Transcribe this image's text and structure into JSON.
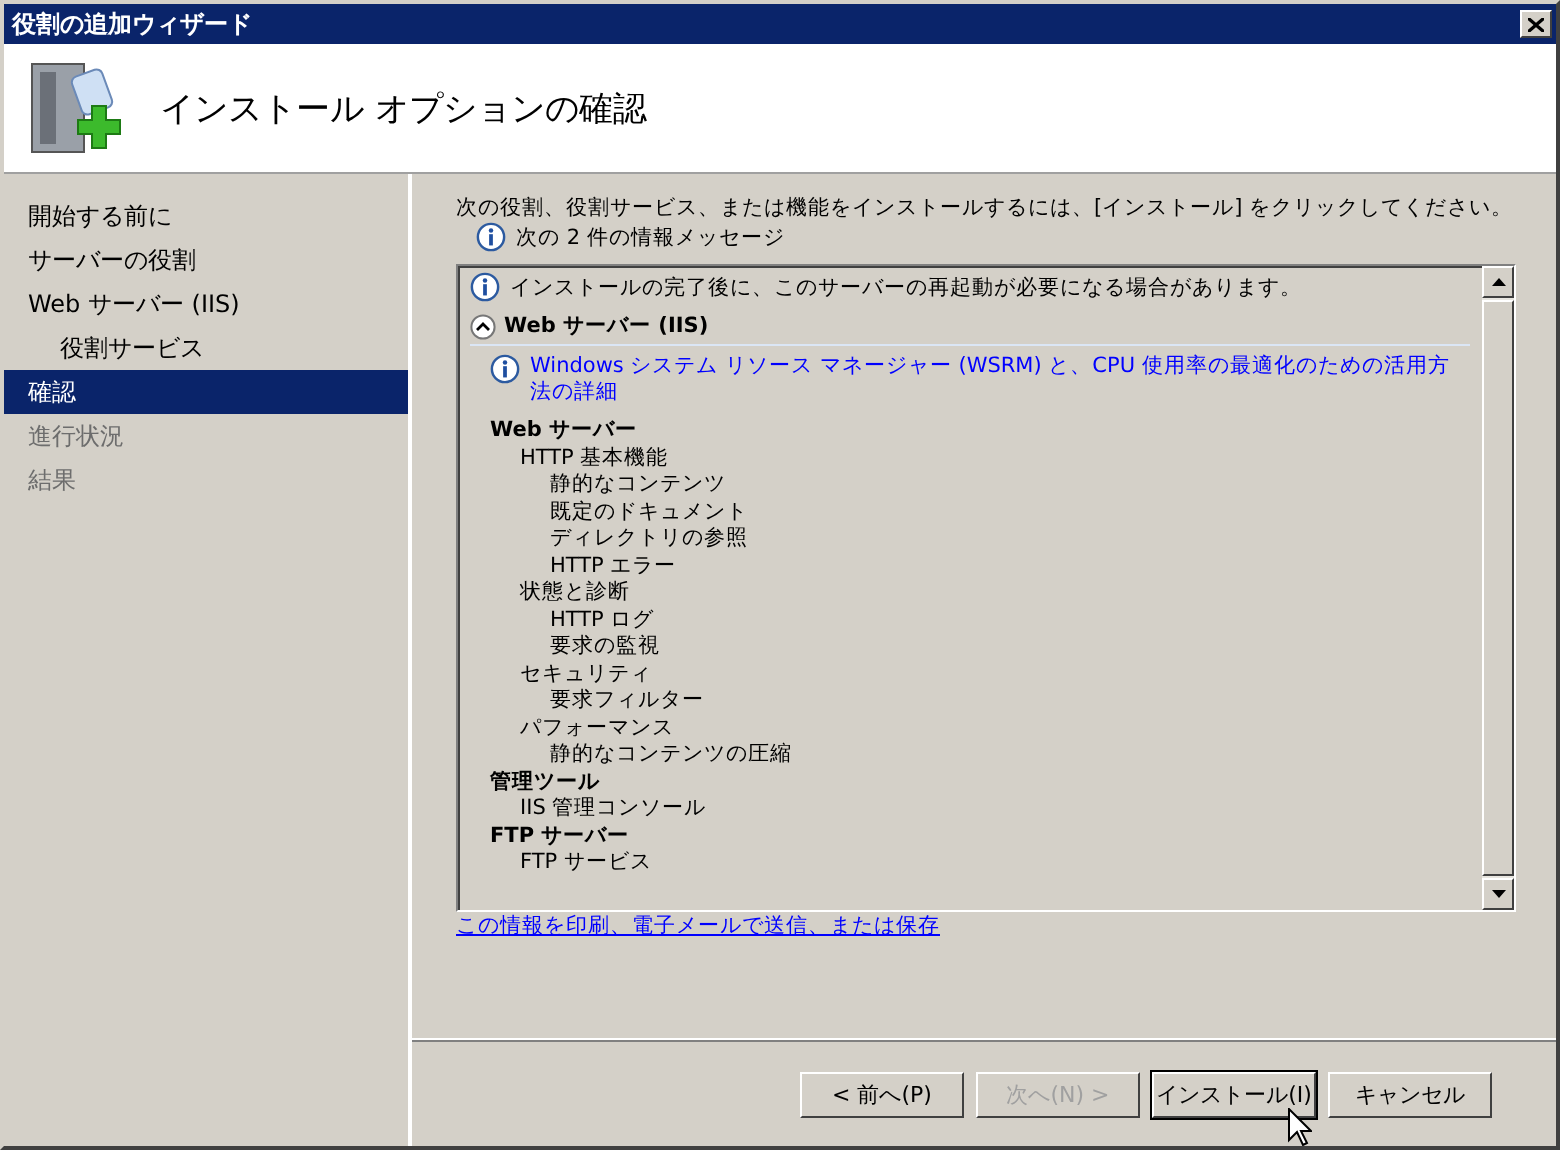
{
  "window": {
    "title": "役割の追加ウィザード"
  },
  "header": {
    "title": "インストール オプションの確認"
  },
  "sidebar": {
    "items": [
      {
        "label": "開始する前に",
        "selected": false,
        "disabled": false,
        "indented": false
      },
      {
        "label": "サーバーの役割",
        "selected": false,
        "disabled": false,
        "indented": false
      },
      {
        "label": "Web サーバー (IIS)",
        "selected": false,
        "disabled": false,
        "indented": false
      },
      {
        "label": "役割サービス",
        "selected": false,
        "disabled": false,
        "indented": true
      },
      {
        "label": "確認",
        "selected": true,
        "disabled": false,
        "indented": false
      },
      {
        "label": "進行状況",
        "selected": false,
        "disabled": true,
        "indented": false
      },
      {
        "label": "結果",
        "selected": false,
        "disabled": true,
        "indented": false
      }
    ]
  },
  "content": {
    "instruction": "次の役割、役割サービス、または機能をインストールするには、[インストール] をクリックしてください。",
    "info_summary": "次の 2 件の情報メッセージ",
    "details": {
      "restart_message": "インストールの完了後に、このサーバーの再起動が必要になる場合があります。",
      "section": {
        "title": "Web サーバー (IIS)",
        "expanded": true
      },
      "link": "Windows システム リソース マネージャー (WSRM) と、CPU 使用率の最適化のための活用方法の詳細",
      "tree": [
        {
          "label": "Web サーバー",
          "children": [
            {
              "label": "HTTP 基本機能",
              "children": [
                {
                  "label": "静的なコンテンツ"
                },
                {
                  "label": "既定のドキュメント"
                },
                {
                  "label": "ディレクトリの参照"
                },
                {
                  "label": "HTTP エラー"
                }
              ]
            },
            {
              "label": "状態と診断",
              "children": [
                {
                  "label": "HTTP ログ"
                },
                {
                  "label": "要求の監視"
                }
              ]
            },
            {
              "label": "セキュリティ",
              "children": [
                {
                  "label": "要求フィルター"
                }
              ]
            },
            {
              "label": "パフォーマンス",
              "children": [
                {
                  "label": "静的なコンテンツの圧縮"
                }
              ]
            }
          ]
        },
        {
          "label": "管理ツール",
          "children": [
            {
              "label": "IIS 管理コンソール"
            }
          ]
        },
        {
          "label": "FTP サーバー",
          "children": [
            {
              "label": "FTP サービス"
            }
          ]
        }
      ]
    },
    "save_link": "この情報を印刷、電子メールで送信、または保存"
  },
  "buttons": [
    {
      "label": "< 前へ(P)",
      "disabled": false,
      "default": false
    },
    {
      "label": "次へ(N) >",
      "disabled": true,
      "default": false
    },
    {
      "label": "インストール(I)",
      "disabled": false,
      "default": true
    },
    {
      "label": "キャンセル",
      "disabled": false,
      "default": false
    }
  ]
}
